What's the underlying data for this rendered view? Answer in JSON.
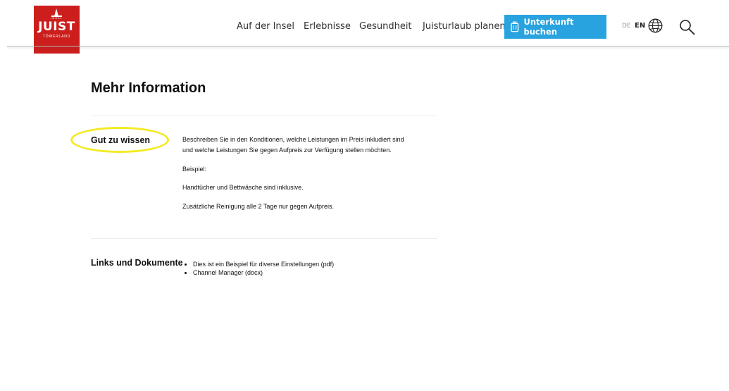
{
  "logo": {
    "top_text": "INSEL",
    "name": "JUIST",
    "subtitle": "TÖWERLAND"
  },
  "nav": {
    "items": [
      "Auf der Insel",
      "Erlebnisse",
      "Gesundheit",
      "Juisturlaub planen"
    ],
    "book_button": "Unterkunft buchen",
    "lang_de": "DE",
    "lang_en": "EN",
    "icons": [
      "suitcase-icon",
      "globe-icon",
      "search-icon"
    ]
  },
  "colors": {
    "brand_red": "#cc1f1d",
    "button_blue": "#29a3df",
    "highlight_yellow": "#f4ea23"
  },
  "main": {
    "title": "Mehr Information",
    "sections": [
      {
        "label": "Gut zu wissen",
        "paragraphs": [
          "Beschreiben Sie in den Konditionen, welche Leistungen im Preis inkludiert sind",
          "und welche Leistungen Sie gegen Aufpreis zur Verfügung stellen möchten.",
          "Beispiel:",
          "Handtücher und Bettwäsche sind inklusive.",
          "Zusätzliche Reinigung alle 2 Tage nur gegen Aufpreis."
        ]
      },
      {
        "label": "Links und Dokumente",
        "links": [
          "Dies ist ein Beispiel für diverse Einstellungen (pdf)",
          "Channel Manager (docx)"
        ]
      }
    ]
  }
}
